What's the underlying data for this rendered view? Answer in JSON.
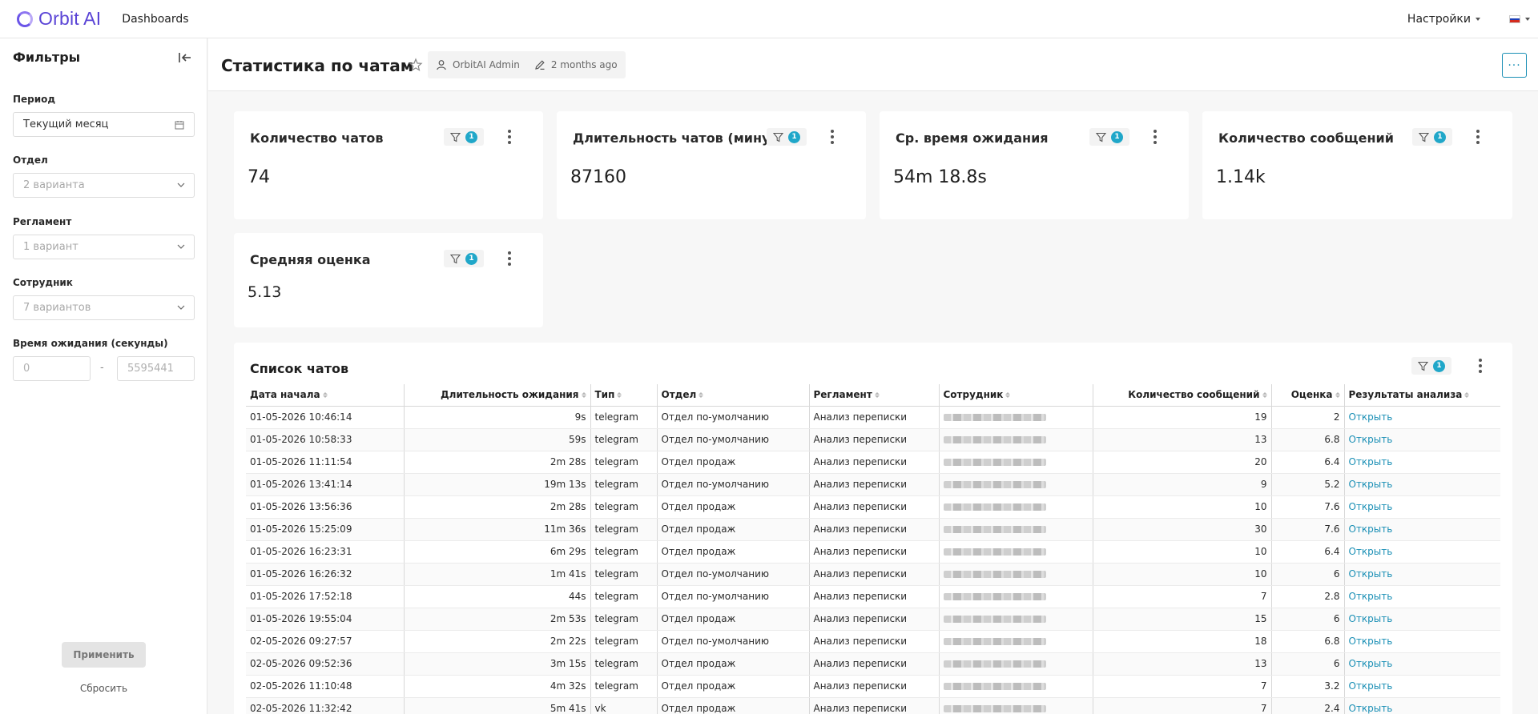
{
  "app": {
    "logo_text": "Orbit AI",
    "nav_dashboards": "Dashboards",
    "settings_label": "Настройки",
    "accent": "#6b55e8",
    "link_color": "#1a8fb5"
  },
  "sidebar": {
    "title": "Фильтры",
    "period": {
      "label": "Период",
      "value": "Текущий месяц"
    },
    "department": {
      "label": "Отдел",
      "placeholder": "2 варианта"
    },
    "regulation": {
      "label": "Регламент",
      "placeholder": "1 вариант"
    },
    "employee": {
      "label": "Сотрудник",
      "placeholder": "7 вариантов"
    },
    "wait_time": {
      "label": "Время ожидания (секунды)",
      "min_placeholder": "0",
      "separator": "-",
      "max_placeholder": "5595441"
    },
    "apply_label": "Применить",
    "reset_label": "Сбросить"
  },
  "header": {
    "title": "Статистика по чатам",
    "author": "OrbitAI Admin",
    "modified": "2 months ago",
    "more": "···"
  },
  "cards": [
    {
      "title": "Количество чатов",
      "value": "74",
      "filter_count": "1"
    },
    {
      "title": "Длительность чатов (минут)",
      "value": "87160",
      "filter_count": "1"
    },
    {
      "title": "Ср. время ожидания",
      "value": "54m 18.8s",
      "filter_count": "1"
    },
    {
      "title": "Количество сообщений",
      "value": "1.14k",
      "filter_count": "1"
    },
    {
      "title": "Средняя оценка",
      "value": "5.13",
      "filter_count": "1"
    }
  ],
  "table": {
    "title": "Список чатов",
    "filter_count": "1",
    "columns": [
      "Дата начала",
      "Длительность ожидания",
      "Тип",
      "Отдел",
      "Регламент",
      "Сотрудник",
      "Количество сообщений",
      "Оценка",
      "Результаты анализа"
    ],
    "rows": [
      [
        "01-05-2026 10:46:14",
        "9s",
        "telegram",
        "Отдел по-умолчанию",
        "Анализ переписки",
        "",
        "19",
        "2",
        "Открыть"
      ],
      [
        "01-05-2026 10:58:33",
        "59s",
        "telegram",
        "Отдел по-умолчанию",
        "Анализ переписки",
        "",
        "13",
        "6.8",
        "Открыть"
      ],
      [
        "01-05-2026 11:11:54",
        "2m 28s",
        "telegram",
        "Отдел продаж",
        "Анализ переписки",
        "",
        "20",
        "6.4",
        "Открыть"
      ],
      [
        "01-05-2026 13:41:14",
        "19m 13s",
        "telegram",
        "Отдел по-умолчанию",
        "Анализ переписки",
        "",
        "9",
        "5.2",
        "Открыть"
      ],
      [
        "01-05-2026 13:56:36",
        "2m 28s",
        "telegram",
        "Отдел продаж",
        "Анализ переписки",
        "",
        "10",
        "7.6",
        "Открыть"
      ],
      [
        "01-05-2026 15:25:09",
        "11m 36s",
        "telegram",
        "Отдел продаж",
        "Анализ переписки",
        "",
        "30",
        "7.6",
        "Открыть"
      ],
      [
        "01-05-2026 16:23:31",
        "6m 29s",
        "telegram",
        "Отдел продаж",
        "Анализ переписки",
        "",
        "10",
        "6.4",
        "Открыть"
      ],
      [
        "01-05-2026 16:26:32",
        "1m 41s",
        "telegram",
        "Отдел по-умолчанию",
        "Анализ переписки",
        "",
        "10",
        "6",
        "Открыть"
      ],
      [
        "01-05-2026 17:52:18",
        "44s",
        "telegram",
        "Отдел по-умолчанию",
        "Анализ переписки",
        "",
        "7",
        "2.8",
        "Открыть"
      ],
      [
        "01-05-2026 19:55:04",
        "2m 53s",
        "telegram",
        "Отдел продаж",
        "Анализ переписки",
        "",
        "15",
        "6",
        "Открыть"
      ],
      [
        "02-05-2026 09:27:57",
        "2m 22s",
        "telegram",
        "Отдел по-умолчанию",
        "Анализ переписки",
        "",
        "18",
        "6.8",
        "Открыть"
      ],
      [
        "02-05-2026 09:52:36",
        "3m 15s",
        "telegram",
        "Отдел продаж",
        "Анализ переписки",
        "",
        "13",
        "6",
        "Открыть"
      ],
      [
        "02-05-2026 11:10:48",
        "4m 32s",
        "telegram",
        "Отдел продаж",
        "Анализ переписки",
        "",
        "7",
        "3.2",
        "Открыть"
      ],
      [
        "02-05-2026 11:32:42",
        "5m 41s",
        "vk",
        "Отдел продаж",
        "Анализ переписки",
        "",
        "7",
        "2.4",
        "Открыть"
      ]
    ]
  }
}
